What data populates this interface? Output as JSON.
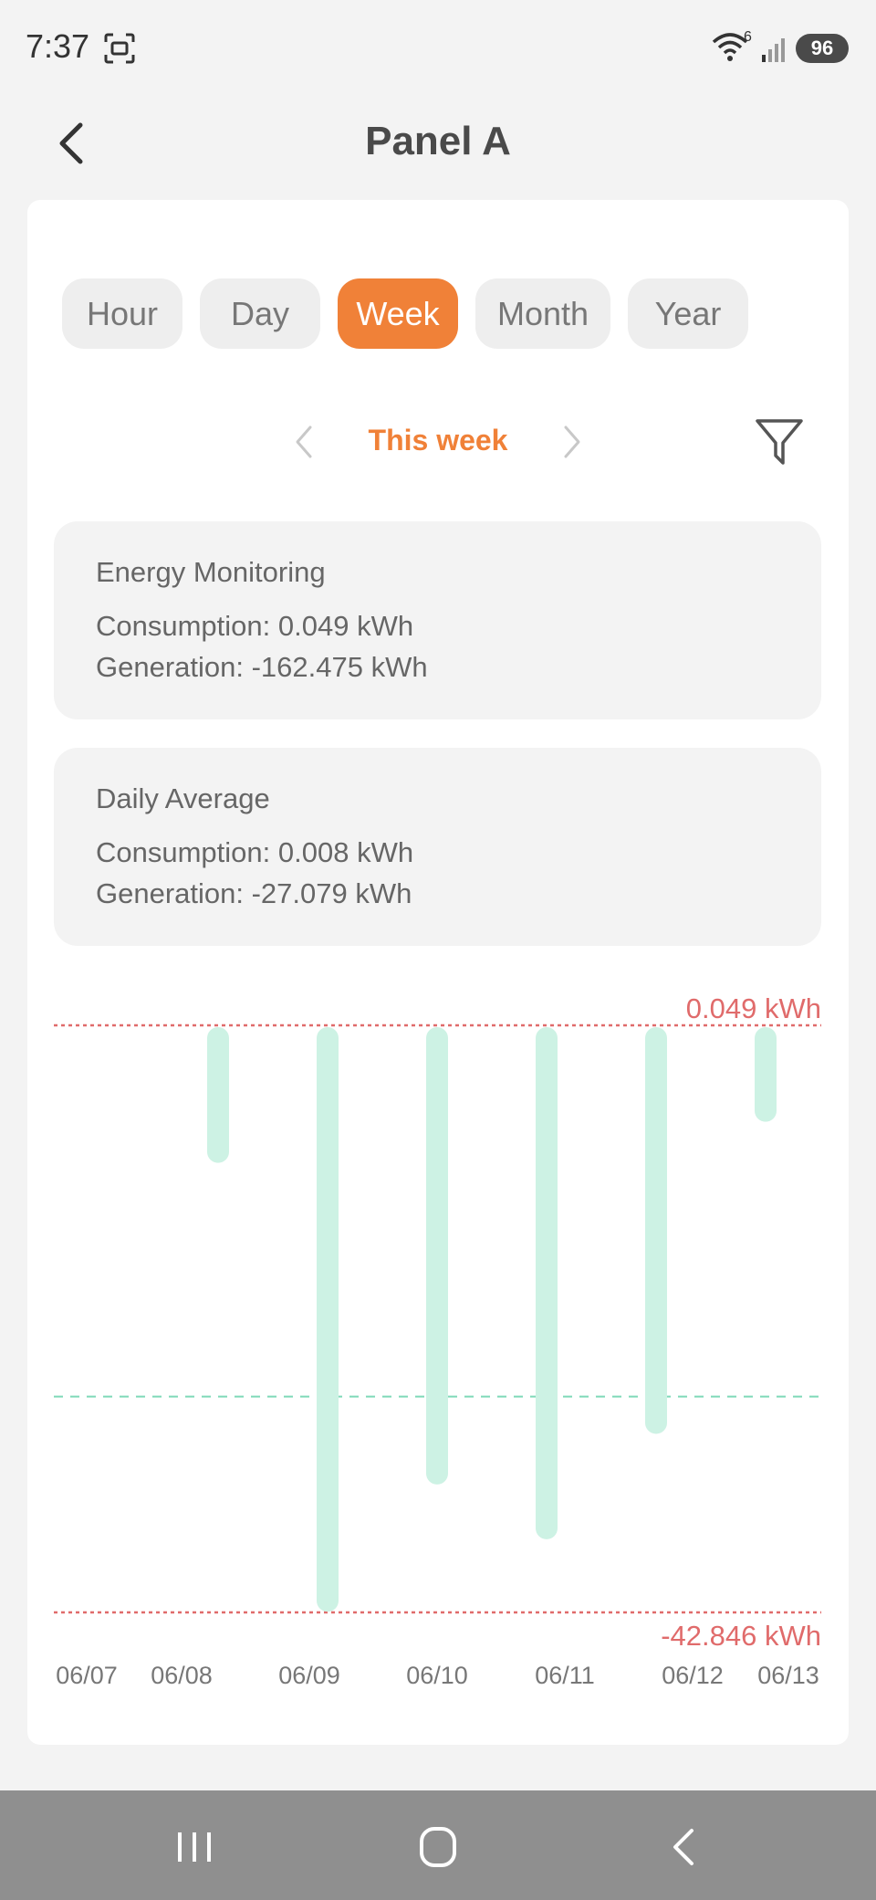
{
  "status": {
    "time": "7:37",
    "wifi_superscript": "6",
    "battery": "96"
  },
  "header": {
    "title": "Panel A"
  },
  "tabs": [
    {
      "label": "Hour",
      "active": false
    },
    {
      "label": "Day",
      "active": false
    },
    {
      "label": "Week",
      "active": true
    },
    {
      "label": "Month",
      "active": false
    },
    {
      "label": "Year",
      "active": false
    }
  ],
  "period": {
    "label": "This week"
  },
  "energy": {
    "title": "Energy Monitoring",
    "consumption": "Consumption: 0.049 kWh",
    "generation": "Generation: -162.475 kWh"
  },
  "average": {
    "title": "Daily Average",
    "consumption": "Consumption: 0.008 kWh",
    "generation": "Generation: -27.079 kWh"
  },
  "colors": {
    "accent": "#f08138",
    "bar": "#cdf2e4",
    "limit_line": "#e06b6b",
    "avg_line": "#7fd9b8"
  },
  "chart_data": {
    "type": "bar",
    "categories": [
      "06/07",
      "06/08",
      "06/09",
      "06/10",
      "06/11",
      "06/12",
      "06/13"
    ],
    "values": [
      0,
      -10.0,
      -42.8,
      -33.5,
      -37.5,
      -29.8,
      -7.0
    ],
    "max_label": "0.049 kWh",
    "min_label": "-42.846 kWh",
    "max_value": 0.049,
    "min_value": -42.846,
    "average_value": -27.079,
    "grid": false
  }
}
